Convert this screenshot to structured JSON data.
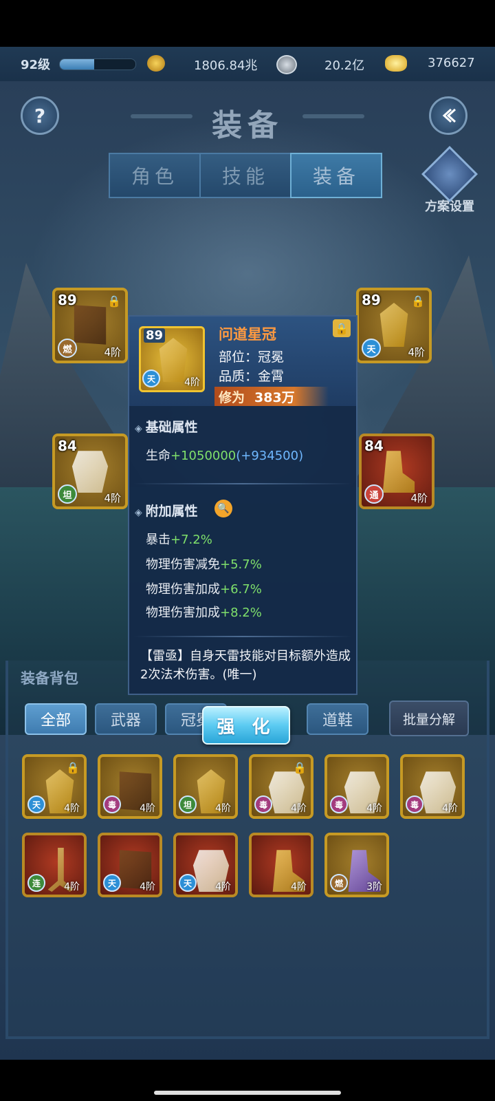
{
  "top_bar": {
    "level": "92级",
    "xp_fraction": 0.45,
    "power": "1806.84兆",
    "coins": "20.2亿",
    "ingots": "376627"
  },
  "header": {
    "title": "装备",
    "help": "?"
  },
  "main_tabs": [
    "角色",
    "技能",
    "装备"
  ],
  "active_tab": 2,
  "plan_settings": "方案设置",
  "equip_slots": [
    {
      "level": "89",
      "badge": "燃",
      "tier": "4阶",
      "icon": "book-icon"
    },
    {
      "level": "89",
      "badge": "天",
      "tier": "4阶",
      "icon": "crown-icon"
    },
    {
      "level": "84",
      "badge": "坦",
      "tier": "4阶",
      "icon": "armor-icon"
    },
    {
      "level": "84",
      "badge": "通",
      "tier": "4阶",
      "icon": "boots-icon"
    }
  ],
  "popup": {
    "level": "89",
    "badge": "天",
    "tier": "4阶",
    "name": "问道星冠",
    "slot": "部位：冠冕",
    "quality": "品质：金霄",
    "cultivation_label": "修为",
    "cultivation_value": "383万",
    "base_title": "基础属性",
    "base_stat": {
      "name": "生命",
      "value": "+1050000",
      "extra": "(+934500)"
    },
    "extra_title": "附加属性",
    "extra_stats": [
      {
        "name": "暴击",
        "value": "+7.2%"
      },
      {
        "name": "物理伤害减免",
        "value": "+5.7%"
      },
      {
        "name": "物理伤害加成",
        "value": "+6.7%"
      },
      {
        "name": "物理伤害加成",
        "value": "+8.2%"
      }
    ],
    "description": "【雷亟】自身天雷技能对目标额外造成2次法术伤害。(唯一)"
  },
  "bag": {
    "title": "装备背包",
    "filters": [
      "全部",
      "武器",
      "冠冕",
      "道鞋"
    ],
    "bulk": "批量分解",
    "enhance": "强 化",
    "items": [
      {
        "badge": "天",
        "tier": "4阶",
        "icon": "crown-icon"
      },
      {
        "badge": "毒",
        "tier": "4阶",
        "icon": "book-icon"
      },
      {
        "badge": "坦",
        "tier": "4阶",
        "icon": "crown-icon"
      },
      {
        "badge": "毒",
        "tier": "4阶",
        "icon": "armor-icon"
      },
      {
        "badge": "毒",
        "tier": "4阶",
        "icon": "armor-icon"
      },
      {
        "badge": "毒",
        "tier": "4阶",
        "icon": "armor-icon"
      },
      {
        "badge": "连",
        "tier": "4阶",
        "icon": "weapon-icon"
      },
      {
        "badge": "天",
        "tier": "4阶",
        "icon": "book-icon"
      },
      {
        "badge": "天",
        "tier": "4阶",
        "icon": "armor-icon"
      },
      {
        "badge": "",
        "tier": "4阶",
        "icon": "boots-icon"
      },
      {
        "badge": "燃",
        "tier": "3阶",
        "icon": "boots-icon"
      }
    ]
  }
}
